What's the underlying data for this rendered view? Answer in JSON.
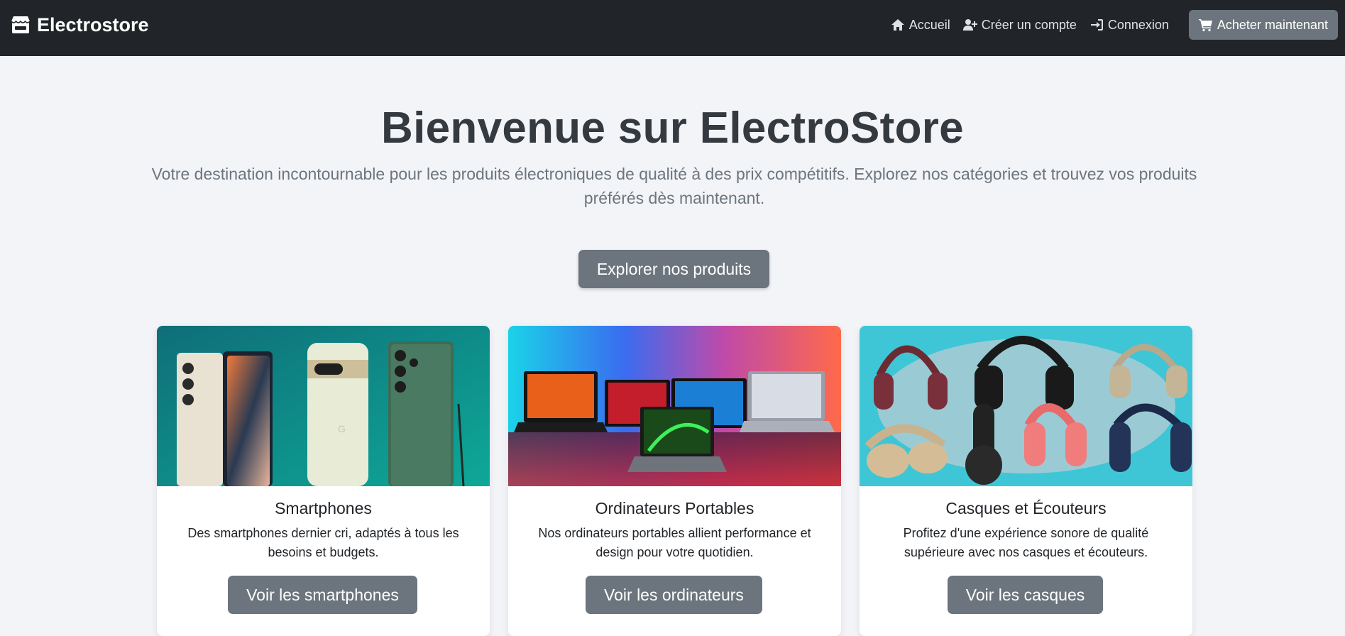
{
  "navbar": {
    "brand": "Electrostore",
    "brand_icon": "store-icon",
    "links": [
      {
        "label": "Accueil",
        "icon": "home-icon"
      },
      {
        "label": "Créer un compte",
        "icon": "user-plus-icon"
      },
      {
        "label": "Connexion",
        "icon": "sign-in-icon"
      }
    ],
    "cta": {
      "label": "Acheter maintenant",
      "icon": "cart-icon"
    }
  },
  "hero": {
    "title": "Bienvenue sur ElectroStore",
    "subtitle": "Votre destination incontournable pour les produits électroniques de qualité à des prix compétitifs. Explorez nos catégories et trouvez vos produits préférés dès maintenant.",
    "button": "Explorer nos produits"
  },
  "categories": [
    {
      "title": "Smartphones",
      "description": "Des smartphones dernier cri, adaptés à tous les besoins et budgets.",
      "button": "Voir les smartphones",
      "image": "smartphones-photo"
    },
    {
      "title": "Ordinateurs Portables",
      "description": "Nos ordinateurs portables allient performance et design pour votre quotidien.",
      "button": "Voir les ordinateurs",
      "image": "laptops-photo"
    },
    {
      "title": "Casques et Écouteurs",
      "description": "Profitez d'une expérience sonore de qualité supérieure avec nos casques et écouteurs.",
      "button": "Voir les casques",
      "image": "headphones-photo"
    }
  ],
  "colors": {
    "navbar_bg": "#212529",
    "page_bg": "#f3f4f8",
    "button_bg": "#6c757d",
    "title_color": "#343a40",
    "subtitle_color": "#6c757d"
  }
}
